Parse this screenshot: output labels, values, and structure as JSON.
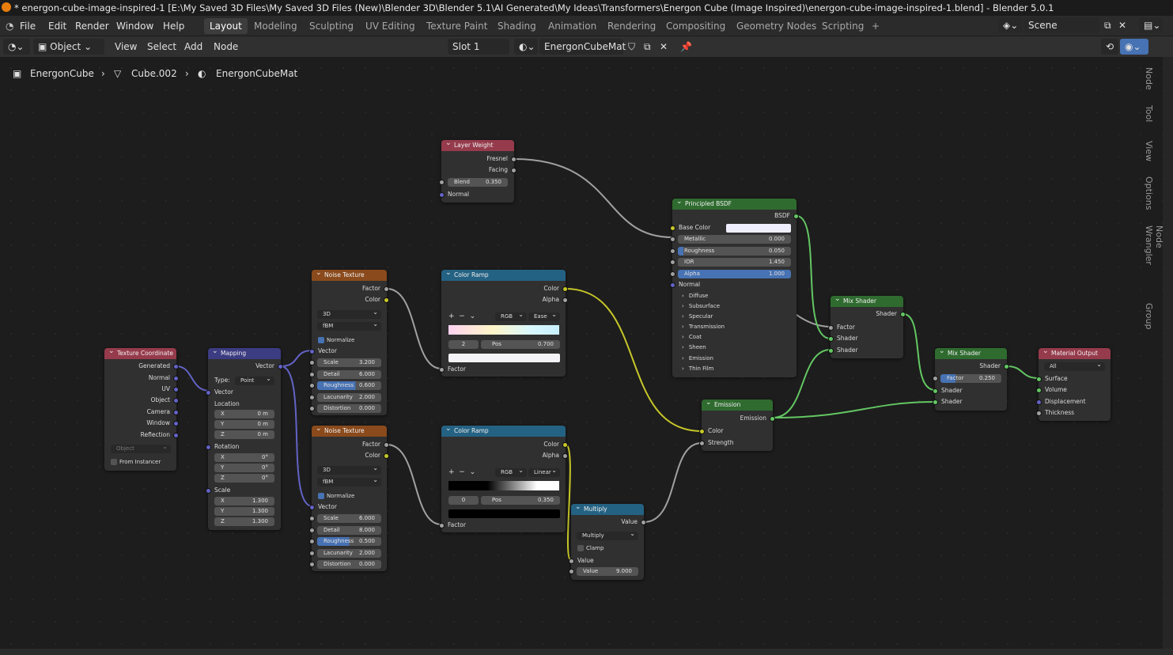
{
  "title": "* energon-cube-image-inspired-1 [E:\\My Saved 3D Files\\My Saved 3D Files (New)\\Blender 3D\\Blender 5.1\\AI Generated\\My Ideas\\Transformers\\Energon Cube (Image Inspired)\\energon-cube-image-inspired-1.blend] - Blender 5.0.1",
  "menu": [
    "File",
    "Edit",
    "Render",
    "Window",
    "Help"
  ],
  "workspaces": [
    "Layout",
    "Modeling",
    "Sculpting",
    "UV Editing",
    "Texture Paint",
    "Shading",
    "Animation",
    "Rendering",
    "Compositing",
    "Geometry Nodes",
    "Scripting",
    "+"
  ],
  "scene": "Scene",
  "header": {
    "mode": "Object",
    "view": "View",
    "select": "Select",
    "add": "Add",
    "node": "Node",
    "slot": "Slot 1",
    "material": "EnergonCubeMat"
  },
  "breadcrumb": {
    "object": "EnergonCube",
    "mesh": "Cube.002",
    "material": "EnergonCubeMat"
  },
  "sidetabs": [
    "Node",
    "Tool",
    "View",
    "Options",
    "Node Wrangler",
    "Group"
  ],
  "nodes": {
    "texcoord": {
      "title": "Texture Coordinate",
      "outputs": [
        "Generated",
        "Normal",
        "UV",
        "Object",
        "Camera",
        "Window",
        "Reflection"
      ],
      "object_placeholder": "Object",
      "from_instancer": "From Instancer"
    },
    "mapping": {
      "title": "Mapping",
      "out": "Vector",
      "type_label": "Type:",
      "type": "Point",
      "in_vector": "Vector",
      "location": "Location",
      "loc": [
        [
          "X",
          "0 m"
        ],
        [
          "Y",
          "0 m"
        ],
        [
          "Z",
          "0 m"
        ]
      ],
      "rotation": "Rotation",
      "rot": [
        [
          "X",
          "0°"
        ],
        [
          "Y",
          "0°"
        ],
        [
          "Z",
          "0°"
        ]
      ],
      "scale": "Scale",
      "scl": [
        [
          "X",
          "1.300"
        ],
        [
          "Y",
          "1.300"
        ],
        [
          "Z",
          "1.300"
        ]
      ]
    },
    "noise1": {
      "title": "Noise Texture",
      "out1": "Factor",
      "out2": "Color",
      "dim": "3D",
      "type": "fBM",
      "normalize": "Normalize",
      "vector": "Vector",
      "fields": [
        [
          "Scale",
          "3.200"
        ],
        [
          "Detail",
          "6.000"
        ],
        [
          "Roughness",
          "0.600"
        ],
        [
          "Lacunarity",
          "2.000"
        ],
        [
          "Distortion",
          "0.000"
        ]
      ]
    },
    "noise2": {
      "title": "Noise Texture",
      "out1": "Factor",
      "out2": "Color",
      "dim": "3D",
      "type": "fBM",
      "normalize": "Normalize",
      "vector": "Vector",
      "fields": [
        [
          "Scale",
          "6.000"
        ],
        [
          "Detail",
          "8.000"
        ],
        [
          "Roughness",
          "0.500"
        ],
        [
          "Lacunarity",
          "2.000"
        ],
        [
          "Distortion",
          "0.000"
        ]
      ]
    },
    "ramp1": {
      "title": "Color Ramp",
      "out1": "Color",
      "out2": "Alpha",
      "mode": "RGB",
      "interp": "Ease",
      "index": "2",
      "pos_label": "Pos",
      "pos": "0.700",
      "in": "Factor"
    },
    "ramp2": {
      "title": "Color Ramp",
      "out1": "Color",
      "out2": "Alpha",
      "mode": "RGB",
      "interp": "Linear",
      "index": "0",
      "pos_label": "Pos",
      "pos": "0.350",
      "in": "Factor"
    },
    "layerweight": {
      "title": "Layer Weight",
      "out1": "Fresnel",
      "out2": "Facing",
      "blend_label": "Blend",
      "blend": "0.350",
      "normal": "Normal"
    },
    "bsdf": {
      "title": "Principled BSDF",
      "out": "BSDF",
      "basecolor": "Base Color",
      "fields": [
        [
          "Metallic",
          "0.000"
        ],
        [
          "Roughness",
          "0.050"
        ],
        [
          "IOR",
          "1.450"
        ],
        [
          "Alpha",
          "1.000"
        ]
      ],
      "normal": "Normal",
      "panels": [
        "Diffuse",
        "Subsurface",
        "Specular",
        "Transmission",
        "Coat",
        "Sheen",
        "Emission",
        "Thin Film"
      ]
    },
    "emission": {
      "title": "Emission",
      "out": "Emission",
      "in1": "Color",
      "in2": "Strength"
    },
    "multiply": {
      "title": "Multiply",
      "out": "Value",
      "op": "Multiply",
      "clamp": "Clamp",
      "in": "Value",
      "val_label": "Value",
      "val": "9.000"
    },
    "mix1": {
      "title": "Mix Shader",
      "out": "Shader",
      "in1": "Factor",
      "in2": "Shader",
      "in3": "Shader"
    },
    "mix2": {
      "title": "Mix Shader",
      "out": "Shader",
      "fac_label": "Factor",
      "fac": "0.250",
      "in2": "Shader",
      "in3": "Shader"
    },
    "output": {
      "title": "Material Output",
      "target": "All",
      "inputs": [
        "Surface",
        "Volume",
        "Displacement",
        "Thickness"
      ]
    }
  }
}
